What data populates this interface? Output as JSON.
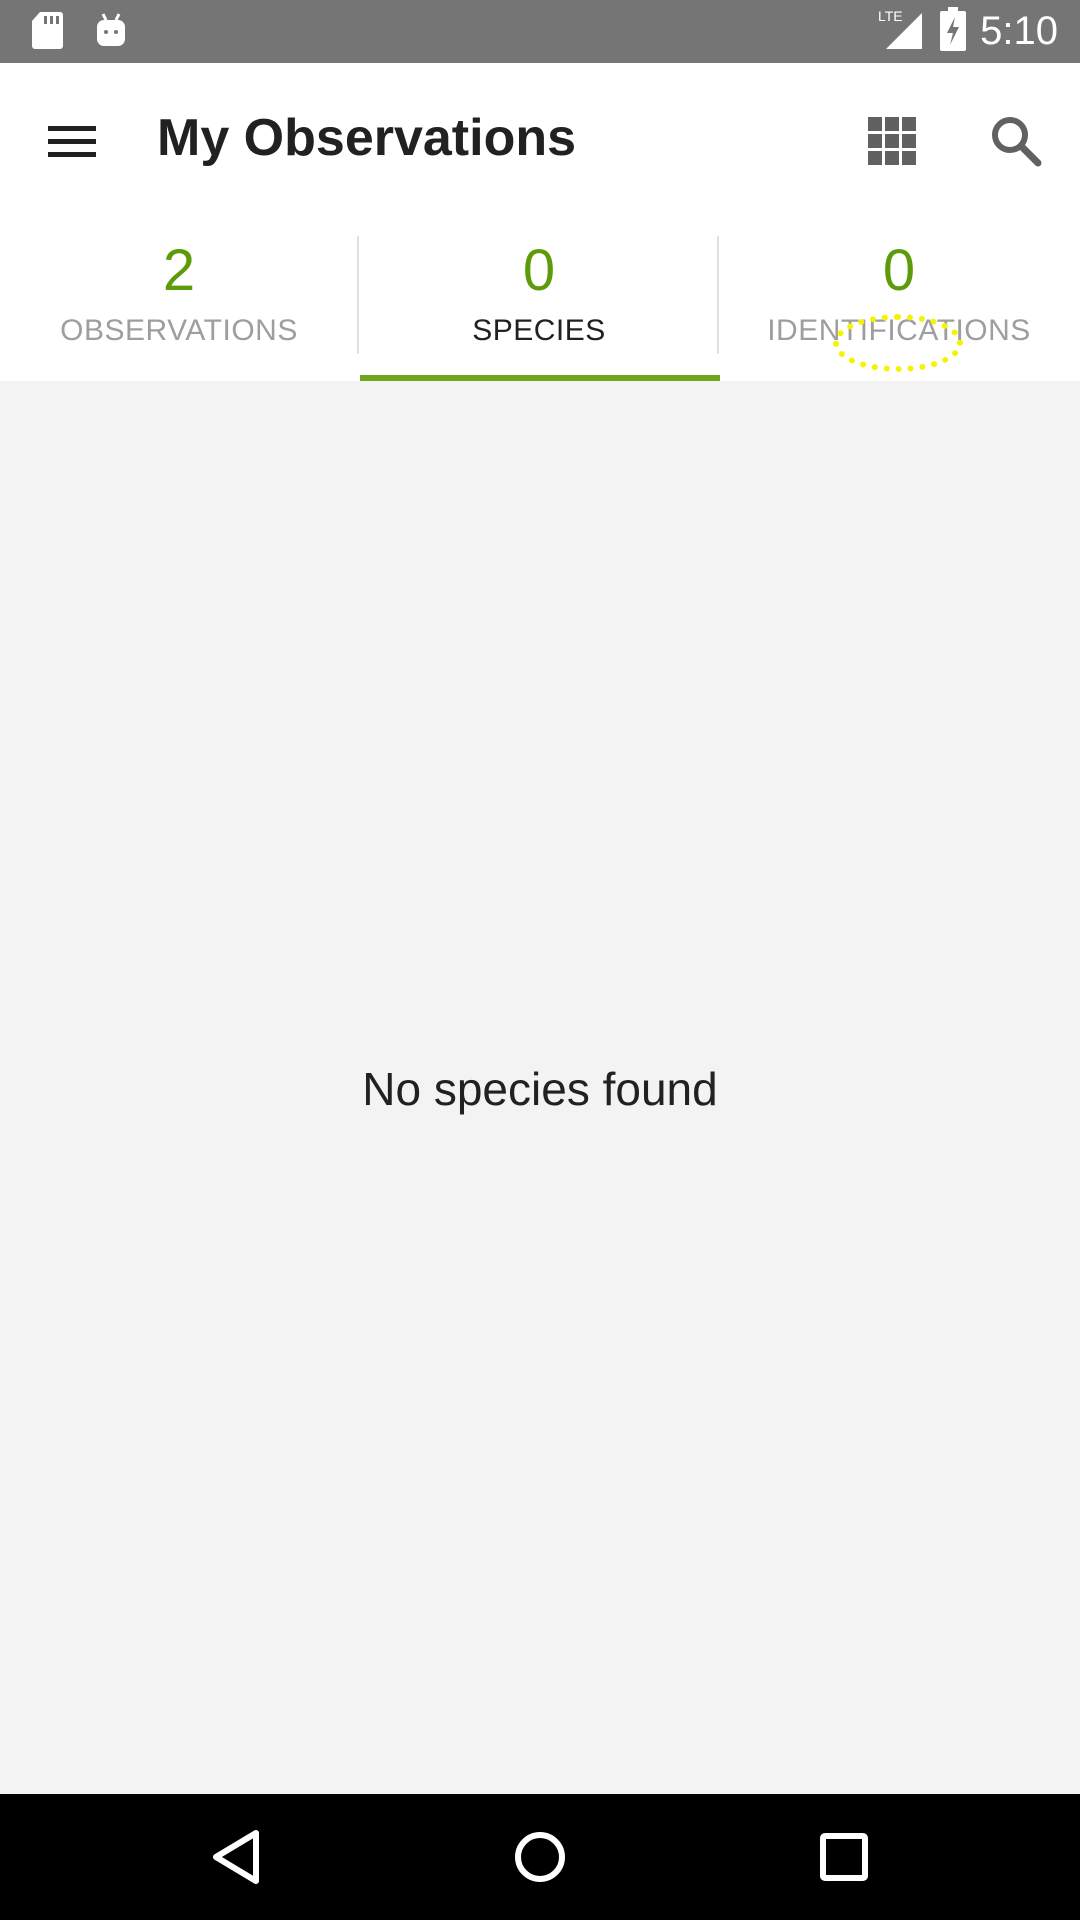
{
  "status_bar": {
    "network": "LTE",
    "time": "5:10",
    "icons": [
      "sd-card-icon",
      "android-icon",
      "lte-signal-icon",
      "battery-charging-icon"
    ]
  },
  "app_bar": {
    "title": "My Observations",
    "icons": [
      "hamburger-menu-icon",
      "grid-view-icon",
      "search-icon"
    ]
  },
  "tabs": [
    {
      "count": "2",
      "label": "OBSERVATIONS",
      "active": false
    },
    {
      "count": "0",
      "label": "SPECIES",
      "active": true
    },
    {
      "count": "0",
      "label": "IDENTIFICATIONS",
      "active": false
    }
  ],
  "content": {
    "empty_message": "No species found"
  },
  "nav_bar": {
    "icons": [
      "back-icon",
      "home-icon",
      "recents-icon"
    ]
  },
  "colors": {
    "accent": "#5e9b0a",
    "indicator": "#6fa61e",
    "status_bar": "#757575",
    "tap_marker": "#f4f400"
  }
}
